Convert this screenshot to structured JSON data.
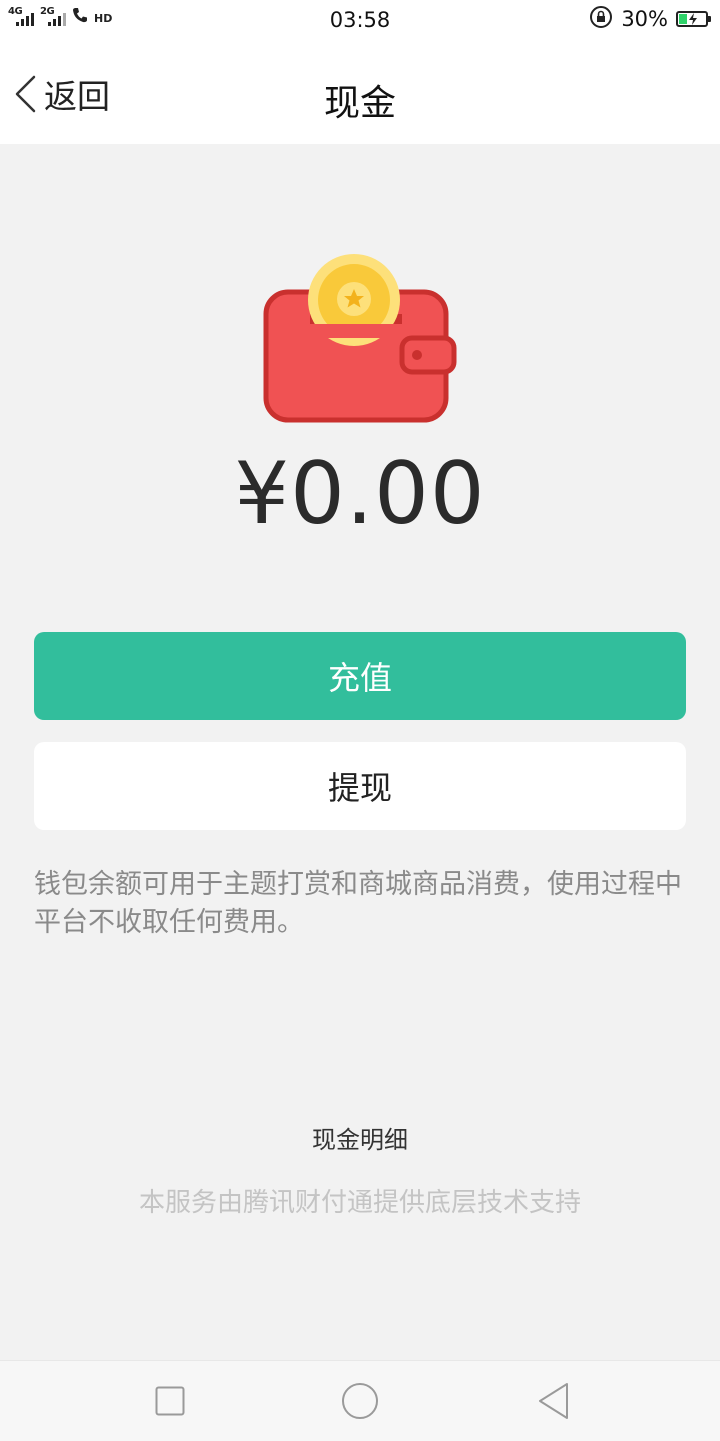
{
  "status_bar": {
    "network_1": "4G",
    "network_2": "2G",
    "hd_label": "HD",
    "time": "03:58",
    "battery_percent": "30%",
    "battery_level": 0.3,
    "icons": [
      "signal-icon",
      "phone-icon",
      "rotation-lock-icon",
      "battery-charging-icon"
    ]
  },
  "header": {
    "back_label": "返回",
    "title": "现金"
  },
  "wallet": {
    "icon": "wallet-coin-icon",
    "colors": {
      "body": "#f05253",
      "outline": "#c9302e",
      "coin": "#f9c93a",
      "coin_light": "#fde07a"
    },
    "balance": "¥0.00"
  },
  "actions": {
    "recharge_label": "充值",
    "withdraw_label": "提现",
    "accent": "#32be9c"
  },
  "notice": "钱包余额可用于主题打赏和商城商品消费，使用过程中平台不收取任何费用。",
  "detail_link": "现金明细",
  "footer_note": "本服务由腾讯财付通提供底层技术支持",
  "nav_bar": {
    "icons": [
      "recent-apps-icon",
      "home-icon",
      "back-icon"
    ]
  }
}
